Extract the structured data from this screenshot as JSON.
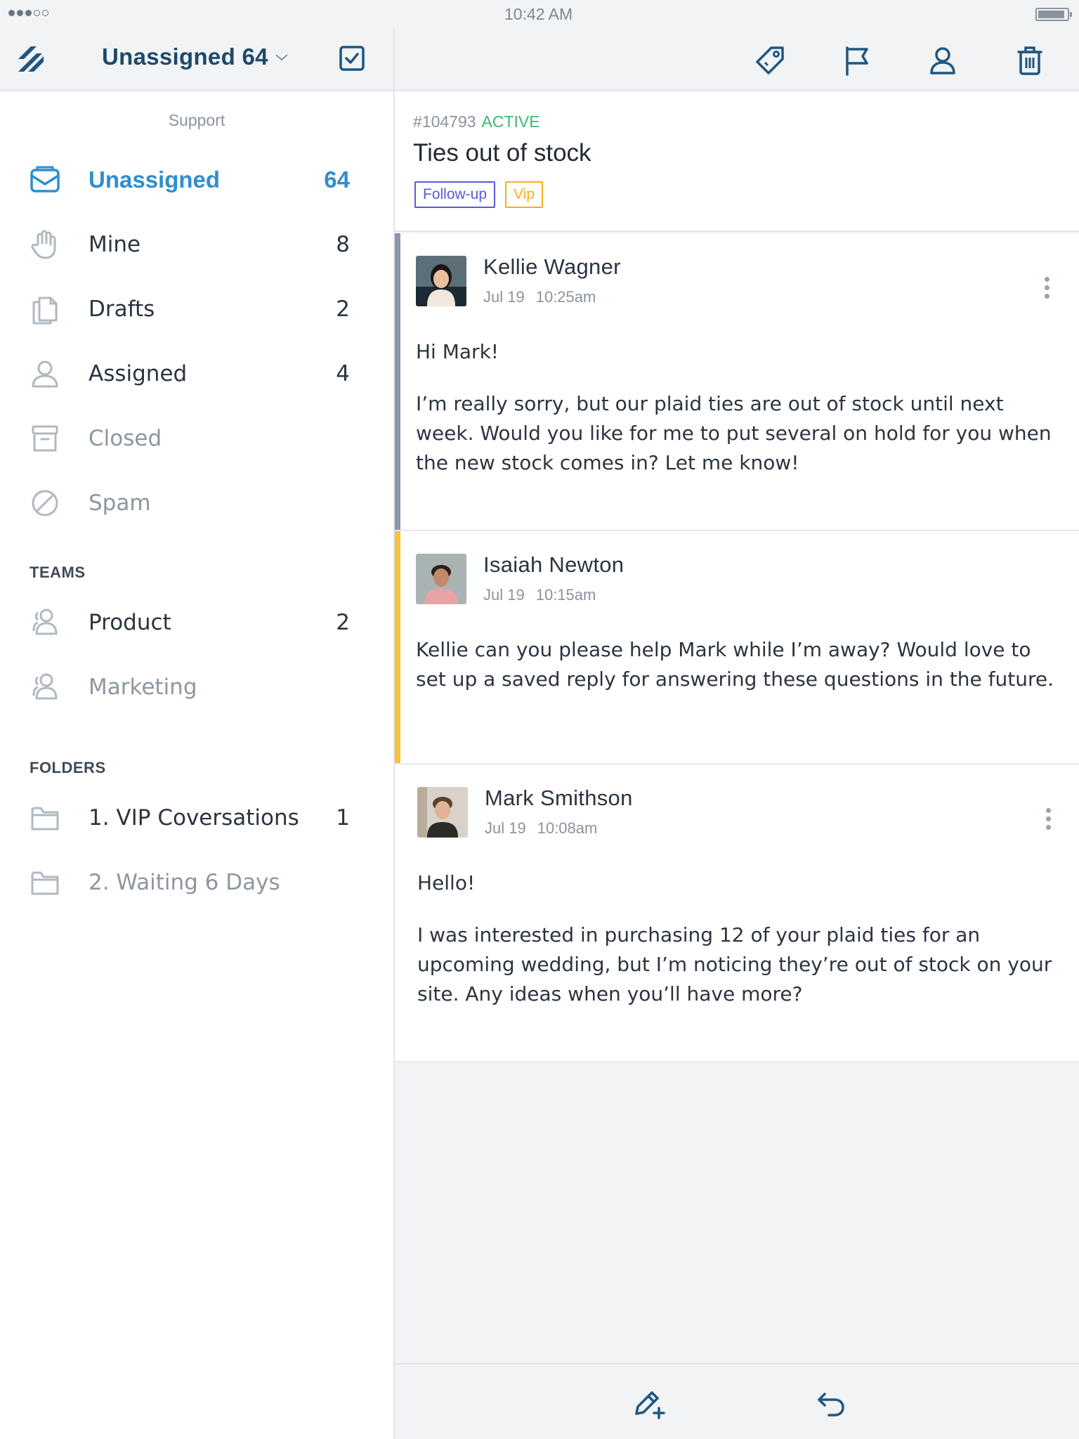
{
  "status_bar": {
    "time": "10:42 AM",
    "signal_bars_filled": 3,
    "signal_bars_total": 5,
    "battery_level": 0.92
  },
  "header": {
    "folder_title": "Unassigned 64",
    "logo_icon": "helpscout-logo-icon",
    "tools": [
      "tag-icon",
      "flag-icon",
      "user-icon",
      "trash-icon"
    ]
  },
  "sidebar": {
    "section": "Support",
    "mailboxes": [
      {
        "label": "Unassigned",
        "count": "64",
        "icon": "inbox-icon",
        "state": "active"
      },
      {
        "label": "Mine",
        "count": "8",
        "icon": "hand-icon",
        "state": "normal"
      },
      {
        "label": "Drafts",
        "count": "2",
        "icon": "drafts-icon",
        "state": "normal"
      },
      {
        "label": "Assigned",
        "count": "4",
        "icon": "person-icon",
        "state": "normal"
      },
      {
        "label": "Closed",
        "count": "",
        "icon": "archive-icon",
        "state": "muted"
      },
      {
        "label": "Spam",
        "count": "",
        "icon": "spam-icon",
        "state": "muted"
      }
    ],
    "teams_heading": "TEAMS",
    "teams": [
      {
        "label": "Product",
        "count": "2",
        "state": "normal"
      },
      {
        "label": "Marketing",
        "count": "",
        "state": "muted"
      }
    ],
    "folders_heading": "FOLDERS",
    "folders": [
      {
        "label": "1. VIP Coversations",
        "count": "1",
        "state": "normal"
      },
      {
        "label": "2. Waiting 6 Days",
        "count": "",
        "state": "muted"
      }
    ]
  },
  "conversation": {
    "ticket_id": "#104793",
    "status": "ACTIVE",
    "subject": "Ties out of stock",
    "tags": [
      {
        "label": "Follow-up",
        "color": "#5a5ad6"
      },
      {
        "label": "Vip",
        "color": "#f2b01e"
      }
    ],
    "messages": [
      {
        "author": "Kellie Wagner",
        "date": "Jul 19",
        "time": "10:25am",
        "bar_color": "#8a97a8",
        "paragraphs": [
          "Hi Mark!",
          "I’m really sorry, but our plaid ties are out of stock until next week. Would you like for me to put several on hold for you when the new stock comes in? Let me know!"
        ]
      },
      {
        "author": "Isaiah Newton",
        "date": "Jul 19",
        "time": "10:15am",
        "bar_color": "#f5c33b",
        "paragraphs": [
          "Kellie can you please help Mark while I’m away? Would love to set up a saved reply for answering these questions in the future."
        ]
      },
      {
        "author": "Mark Smithson",
        "date": "Jul 19",
        "time": "10:08am",
        "bar_color": "",
        "paragraphs": [
          "Hello!",
          "I was interested in purchasing 12 of your plaid ties for an upcoming wedding, but I’m noticing they’re out of stock on your site. Any ideas when you’ll have more?"
        ]
      }
    ]
  },
  "bottom_bar": {
    "actions": [
      "new-note-icon",
      "reply-icon"
    ]
  },
  "colors": {
    "brand_dark": "#1e4a68",
    "accent_blue": "#2e8ecf",
    "active_green": "#3cb878"
  }
}
